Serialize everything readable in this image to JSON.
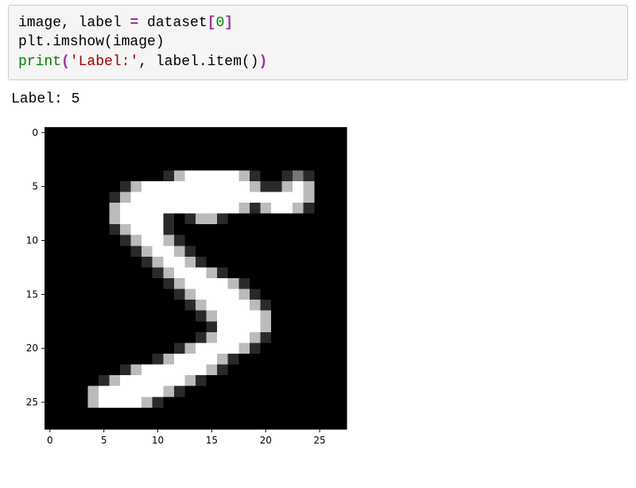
{
  "code": {
    "line1": {
      "pre": "image, label ",
      "op": "=",
      "mid": " dataset",
      "br_o": "[",
      "idx": "0",
      "br_c": "]"
    },
    "line2": "plt.imshow(image)",
    "line3": {
      "fn": "print",
      "p_o": "(",
      "str": "'Label:'",
      "comma": ", ",
      "rest": "label.item()",
      "p_c": ")"
    }
  },
  "output": "Label: 5",
  "chart_data": {
    "type": "heatmap",
    "title": "",
    "xlabel": "",
    "ylabel": "",
    "x_ticks": [
      0,
      5,
      10,
      15,
      20,
      25
    ],
    "y_ticks": [
      0,
      5,
      10,
      15,
      20,
      25
    ],
    "xlim": [
      -0.5,
      27.5
    ],
    "ylim": [
      27.5,
      -0.5
    ],
    "rows": 28,
    "cols": 28,
    "label_value": 5,
    "explicit_colors": [
      "#000000",
      "#ffffff",
      "#666666",
      "#333333",
      "#bbbbbb"
    ],
    "values": [
      "0000000000000000000000000000",
      "0000000000000000000000000000",
      "0000000000000000000000000000",
      "0000000000000000000000000000",
      "0000000000001111111000010000",
      "0000000011111111111100111000",
      "0000000111111111111111111000",
      "0000001111111111111011110000",
      "0000001111100011000000000000",
      "0000000111100000000000000000",
      "0000000011110000000000000000",
      "0000000001111000000000000000",
      "0000000000111100000000000000",
      "0000000000011111000000000000",
      "0000000000001111110000000000",
      "0000000000000111111000000000",
      "0000000000000011111100000000",
      "0000000000000001111110000000",
      "0000000000000000111110000000",
      "0000000000000001111100000000",
      "0000000000000111111000000000",
      "0000000000011111100000000000",
      "0000000011111111000000000000",
      "0000001111111100000000000000",
      "0000111111110000000000000000",
      "0000111111000000000000000000",
      "0000000000000000000000000000",
      "0000000000000000000000000000"
    ]
  }
}
